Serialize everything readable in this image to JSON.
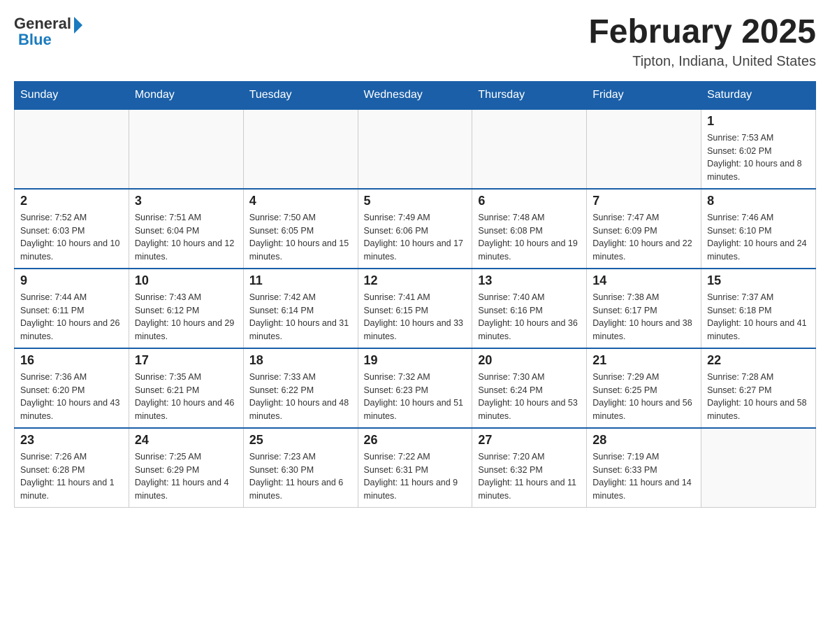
{
  "header": {
    "logo_general": "General",
    "logo_blue": "Blue",
    "title": "February 2025",
    "location": "Tipton, Indiana, United States"
  },
  "weekdays": [
    "Sunday",
    "Monday",
    "Tuesday",
    "Wednesday",
    "Thursday",
    "Friday",
    "Saturday"
  ],
  "weeks": [
    {
      "days": [
        {
          "number": "",
          "info": ""
        },
        {
          "number": "",
          "info": ""
        },
        {
          "number": "",
          "info": ""
        },
        {
          "number": "",
          "info": ""
        },
        {
          "number": "",
          "info": ""
        },
        {
          "number": "",
          "info": ""
        },
        {
          "number": "1",
          "info": "Sunrise: 7:53 AM\nSunset: 6:02 PM\nDaylight: 10 hours and 8 minutes."
        }
      ]
    },
    {
      "days": [
        {
          "number": "2",
          "info": "Sunrise: 7:52 AM\nSunset: 6:03 PM\nDaylight: 10 hours and 10 minutes."
        },
        {
          "number": "3",
          "info": "Sunrise: 7:51 AM\nSunset: 6:04 PM\nDaylight: 10 hours and 12 minutes."
        },
        {
          "number": "4",
          "info": "Sunrise: 7:50 AM\nSunset: 6:05 PM\nDaylight: 10 hours and 15 minutes."
        },
        {
          "number": "5",
          "info": "Sunrise: 7:49 AM\nSunset: 6:06 PM\nDaylight: 10 hours and 17 minutes."
        },
        {
          "number": "6",
          "info": "Sunrise: 7:48 AM\nSunset: 6:08 PM\nDaylight: 10 hours and 19 minutes."
        },
        {
          "number": "7",
          "info": "Sunrise: 7:47 AM\nSunset: 6:09 PM\nDaylight: 10 hours and 22 minutes."
        },
        {
          "number": "8",
          "info": "Sunrise: 7:46 AM\nSunset: 6:10 PM\nDaylight: 10 hours and 24 minutes."
        }
      ]
    },
    {
      "days": [
        {
          "number": "9",
          "info": "Sunrise: 7:44 AM\nSunset: 6:11 PM\nDaylight: 10 hours and 26 minutes."
        },
        {
          "number": "10",
          "info": "Sunrise: 7:43 AM\nSunset: 6:12 PM\nDaylight: 10 hours and 29 minutes."
        },
        {
          "number": "11",
          "info": "Sunrise: 7:42 AM\nSunset: 6:14 PM\nDaylight: 10 hours and 31 minutes."
        },
        {
          "number": "12",
          "info": "Sunrise: 7:41 AM\nSunset: 6:15 PM\nDaylight: 10 hours and 33 minutes."
        },
        {
          "number": "13",
          "info": "Sunrise: 7:40 AM\nSunset: 6:16 PM\nDaylight: 10 hours and 36 minutes."
        },
        {
          "number": "14",
          "info": "Sunrise: 7:38 AM\nSunset: 6:17 PM\nDaylight: 10 hours and 38 minutes."
        },
        {
          "number": "15",
          "info": "Sunrise: 7:37 AM\nSunset: 6:18 PM\nDaylight: 10 hours and 41 minutes."
        }
      ]
    },
    {
      "days": [
        {
          "number": "16",
          "info": "Sunrise: 7:36 AM\nSunset: 6:20 PM\nDaylight: 10 hours and 43 minutes."
        },
        {
          "number": "17",
          "info": "Sunrise: 7:35 AM\nSunset: 6:21 PM\nDaylight: 10 hours and 46 minutes."
        },
        {
          "number": "18",
          "info": "Sunrise: 7:33 AM\nSunset: 6:22 PM\nDaylight: 10 hours and 48 minutes."
        },
        {
          "number": "19",
          "info": "Sunrise: 7:32 AM\nSunset: 6:23 PM\nDaylight: 10 hours and 51 minutes."
        },
        {
          "number": "20",
          "info": "Sunrise: 7:30 AM\nSunset: 6:24 PM\nDaylight: 10 hours and 53 minutes."
        },
        {
          "number": "21",
          "info": "Sunrise: 7:29 AM\nSunset: 6:25 PM\nDaylight: 10 hours and 56 minutes."
        },
        {
          "number": "22",
          "info": "Sunrise: 7:28 AM\nSunset: 6:27 PM\nDaylight: 10 hours and 58 minutes."
        }
      ]
    },
    {
      "days": [
        {
          "number": "23",
          "info": "Sunrise: 7:26 AM\nSunset: 6:28 PM\nDaylight: 11 hours and 1 minute."
        },
        {
          "number": "24",
          "info": "Sunrise: 7:25 AM\nSunset: 6:29 PM\nDaylight: 11 hours and 4 minutes."
        },
        {
          "number": "25",
          "info": "Sunrise: 7:23 AM\nSunset: 6:30 PM\nDaylight: 11 hours and 6 minutes."
        },
        {
          "number": "26",
          "info": "Sunrise: 7:22 AM\nSunset: 6:31 PM\nDaylight: 11 hours and 9 minutes."
        },
        {
          "number": "27",
          "info": "Sunrise: 7:20 AM\nSunset: 6:32 PM\nDaylight: 11 hours and 11 minutes."
        },
        {
          "number": "28",
          "info": "Sunrise: 7:19 AM\nSunset: 6:33 PM\nDaylight: 11 hours and 14 minutes."
        },
        {
          "number": "",
          "info": ""
        }
      ]
    }
  ]
}
